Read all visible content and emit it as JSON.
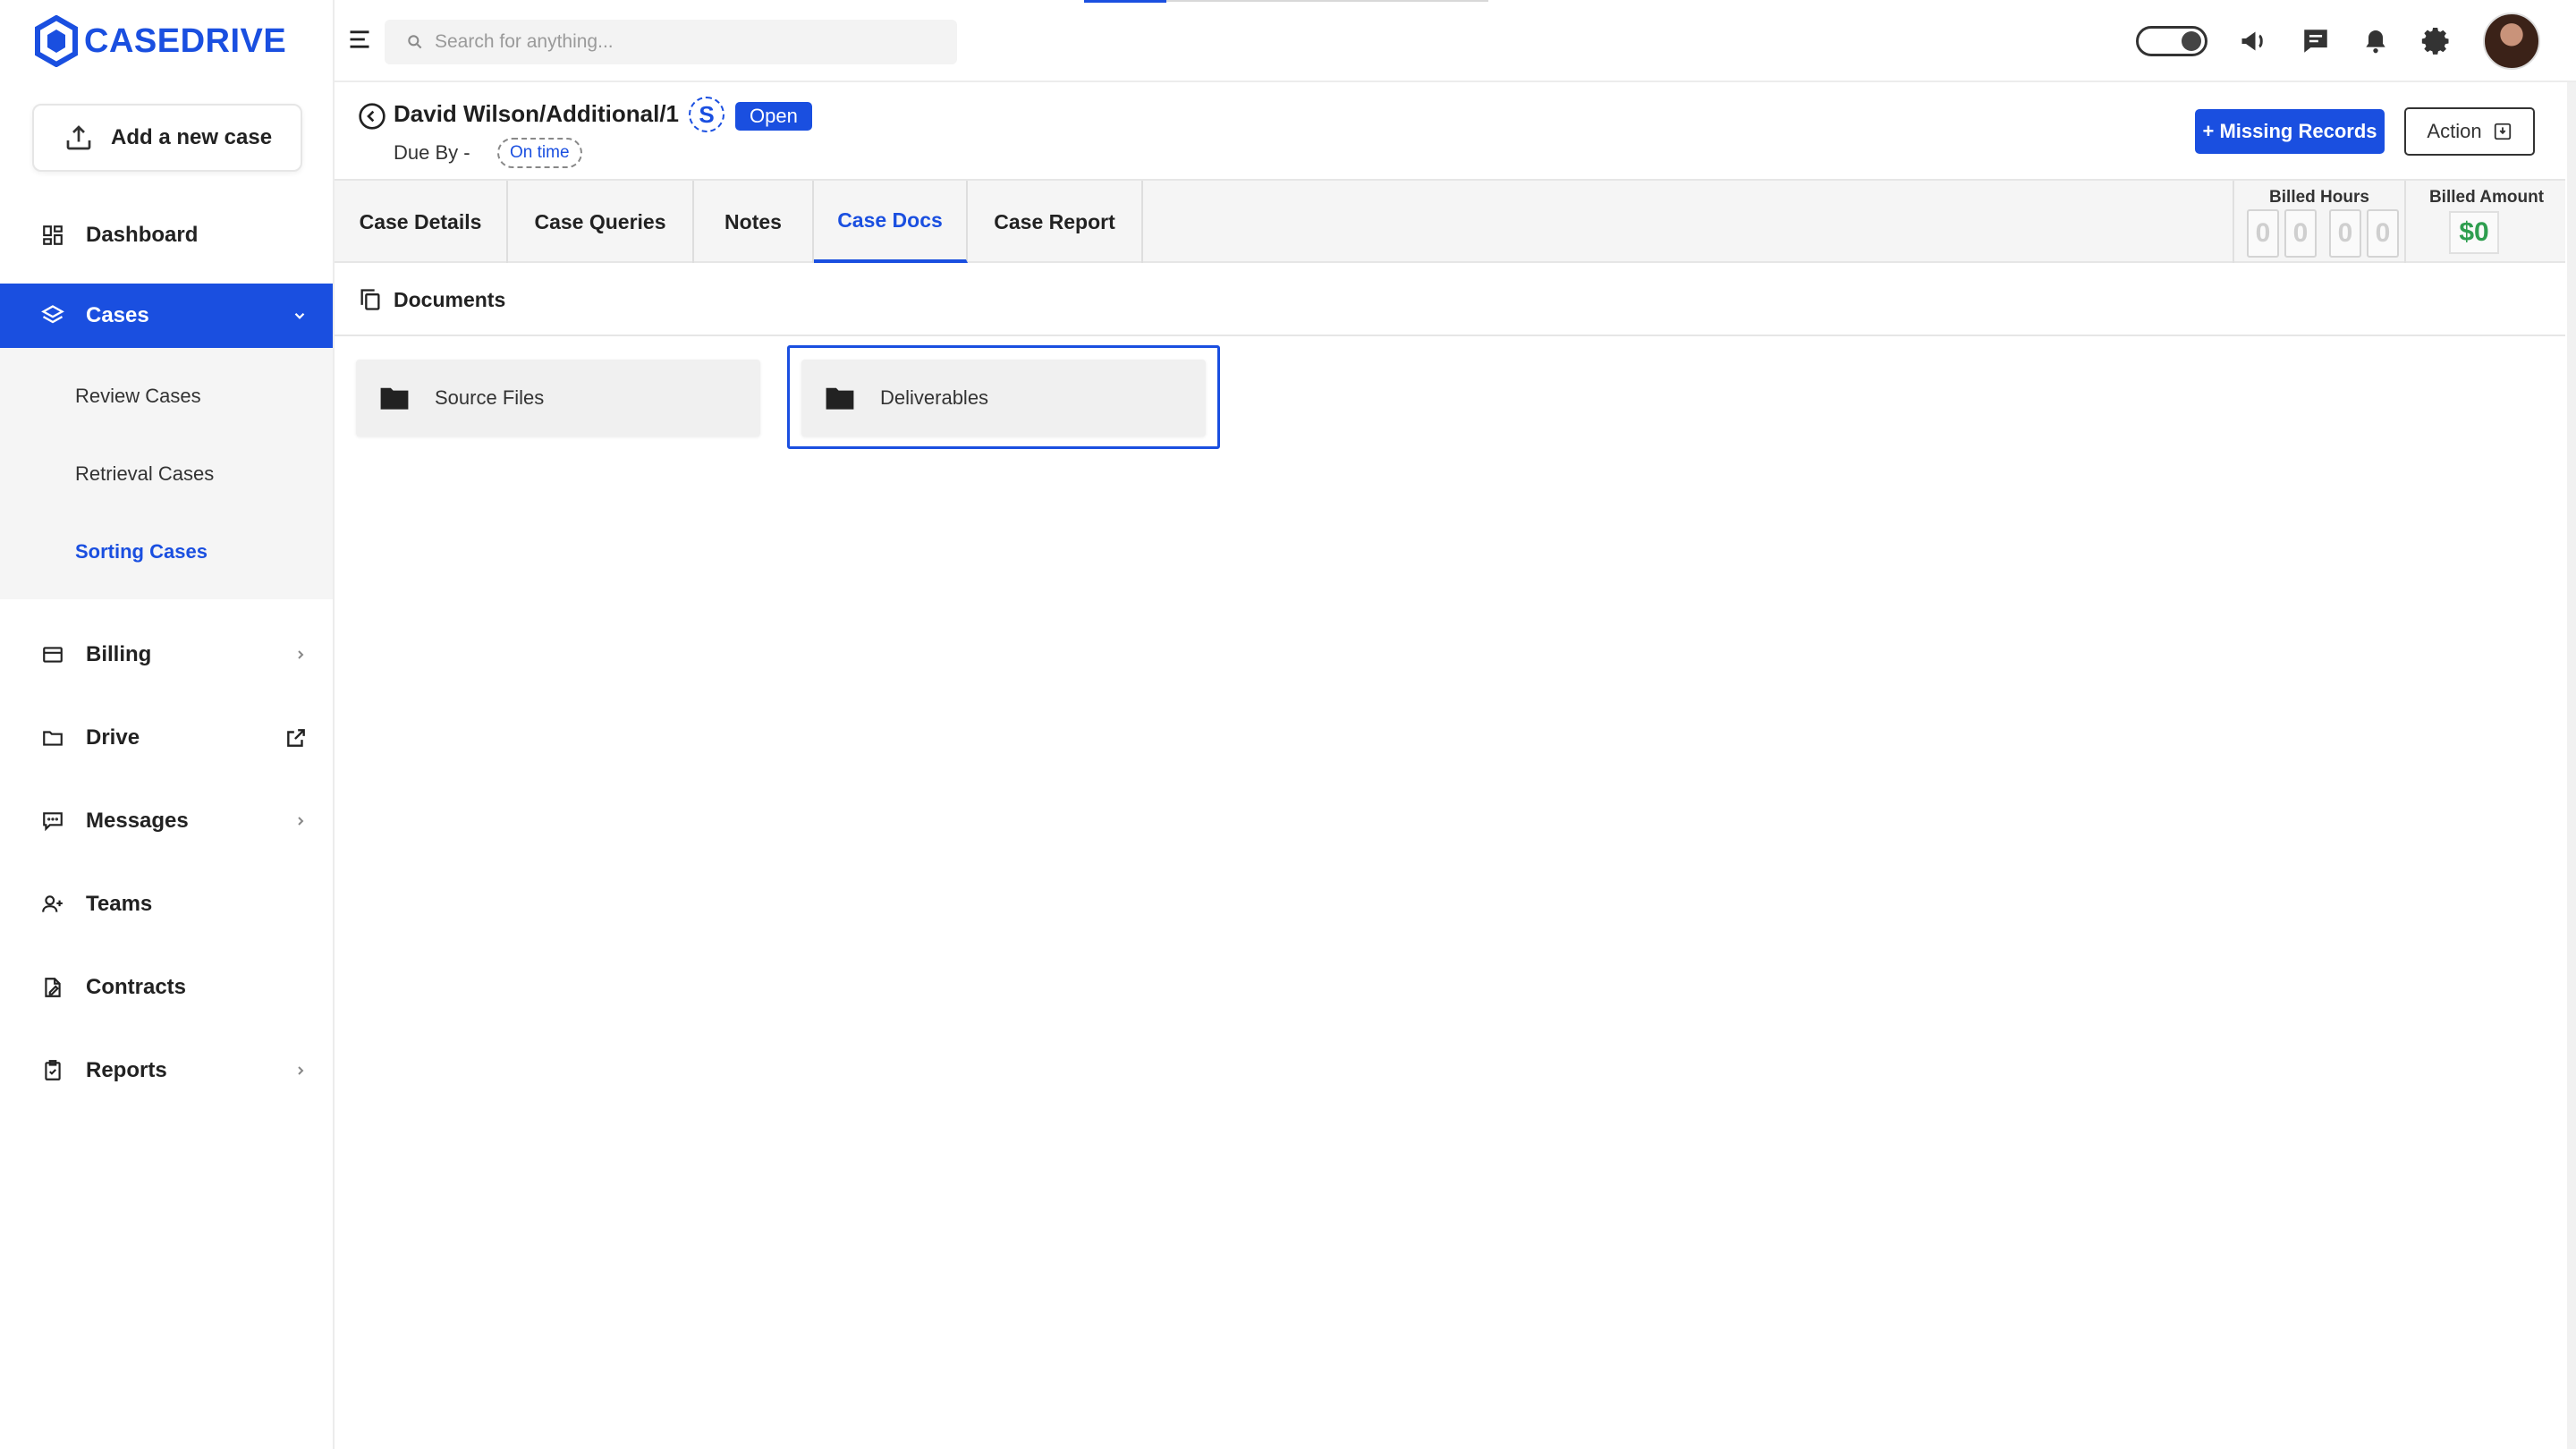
{
  "app": {
    "logo_text": "CASEDRIVE"
  },
  "sidebar": {
    "add_case_label": "Add a new case",
    "items": [
      {
        "label": "Dashboard",
        "icon": "dashboard-icon"
      },
      {
        "label": "Cases",
        "icon": "layers-icon",
        "active": true
      },
      {
        "label": "Billing",
        "icon": "card-icon"
      },
      {
        "label": "Drive",
        "icon": "folder-icon"
      },
      {
        "label": "Messages",
        "icon": "message-icon"
      },
      {
        "label": "Teams",
        "icon": "team-icon"
      },
      {
        "label": "Contracts",
        "icon": "contract-icon"
      },
      {
        "label": "Reports",
        "icon": "clipboard-icon"
      }
    ],
    "cases_sub": [
      {
        "label": "Review Cases"
      },
      {
        "label": "Retrieval Cases"
      },
      {
        "label": "Sorting Cases",
        "active": true
      }
    ]
  },
  "topbar": {
    "search_placeholder": "Search for anything..."
  },
  "case": {
    "title": "David Wilson/Additional/1",
    "s_badge": "S",
    "status": "Open",
    "due_label": "Due By -",
    "timing": "On time",
    "missing_records_label": "+ Missing Records",
    "action_label": "Action"
  },
  "tabs": [
    {
      "label": "Case Details"
    },
    {
      "label": "Case Queries"
    },
    {
      "label": "Notes"
    },
    {
      "label": "Case Docs",
      "active": true
    },
    {
      "label": "Case Report"
    }
  ],
  "billing": {
    "hours_title": "Billed Hours",
    "hours_digits": [
      "0",
      "0",
      "0",
      "0"
    ],
    "amount_title": "Billed Amount",
    "amount_value": "$0"
  },
  "documents": {
    "heading": "Documents",
    "folders": [
      {
        "label": "Source Files"
      },
      {
        "label": "Deliverables",
        "selected": true
      }
    ]
  },
  "colors": {
    "accent": "#1a4fe0",
    "money": "#2e9e4f"
  }
}
